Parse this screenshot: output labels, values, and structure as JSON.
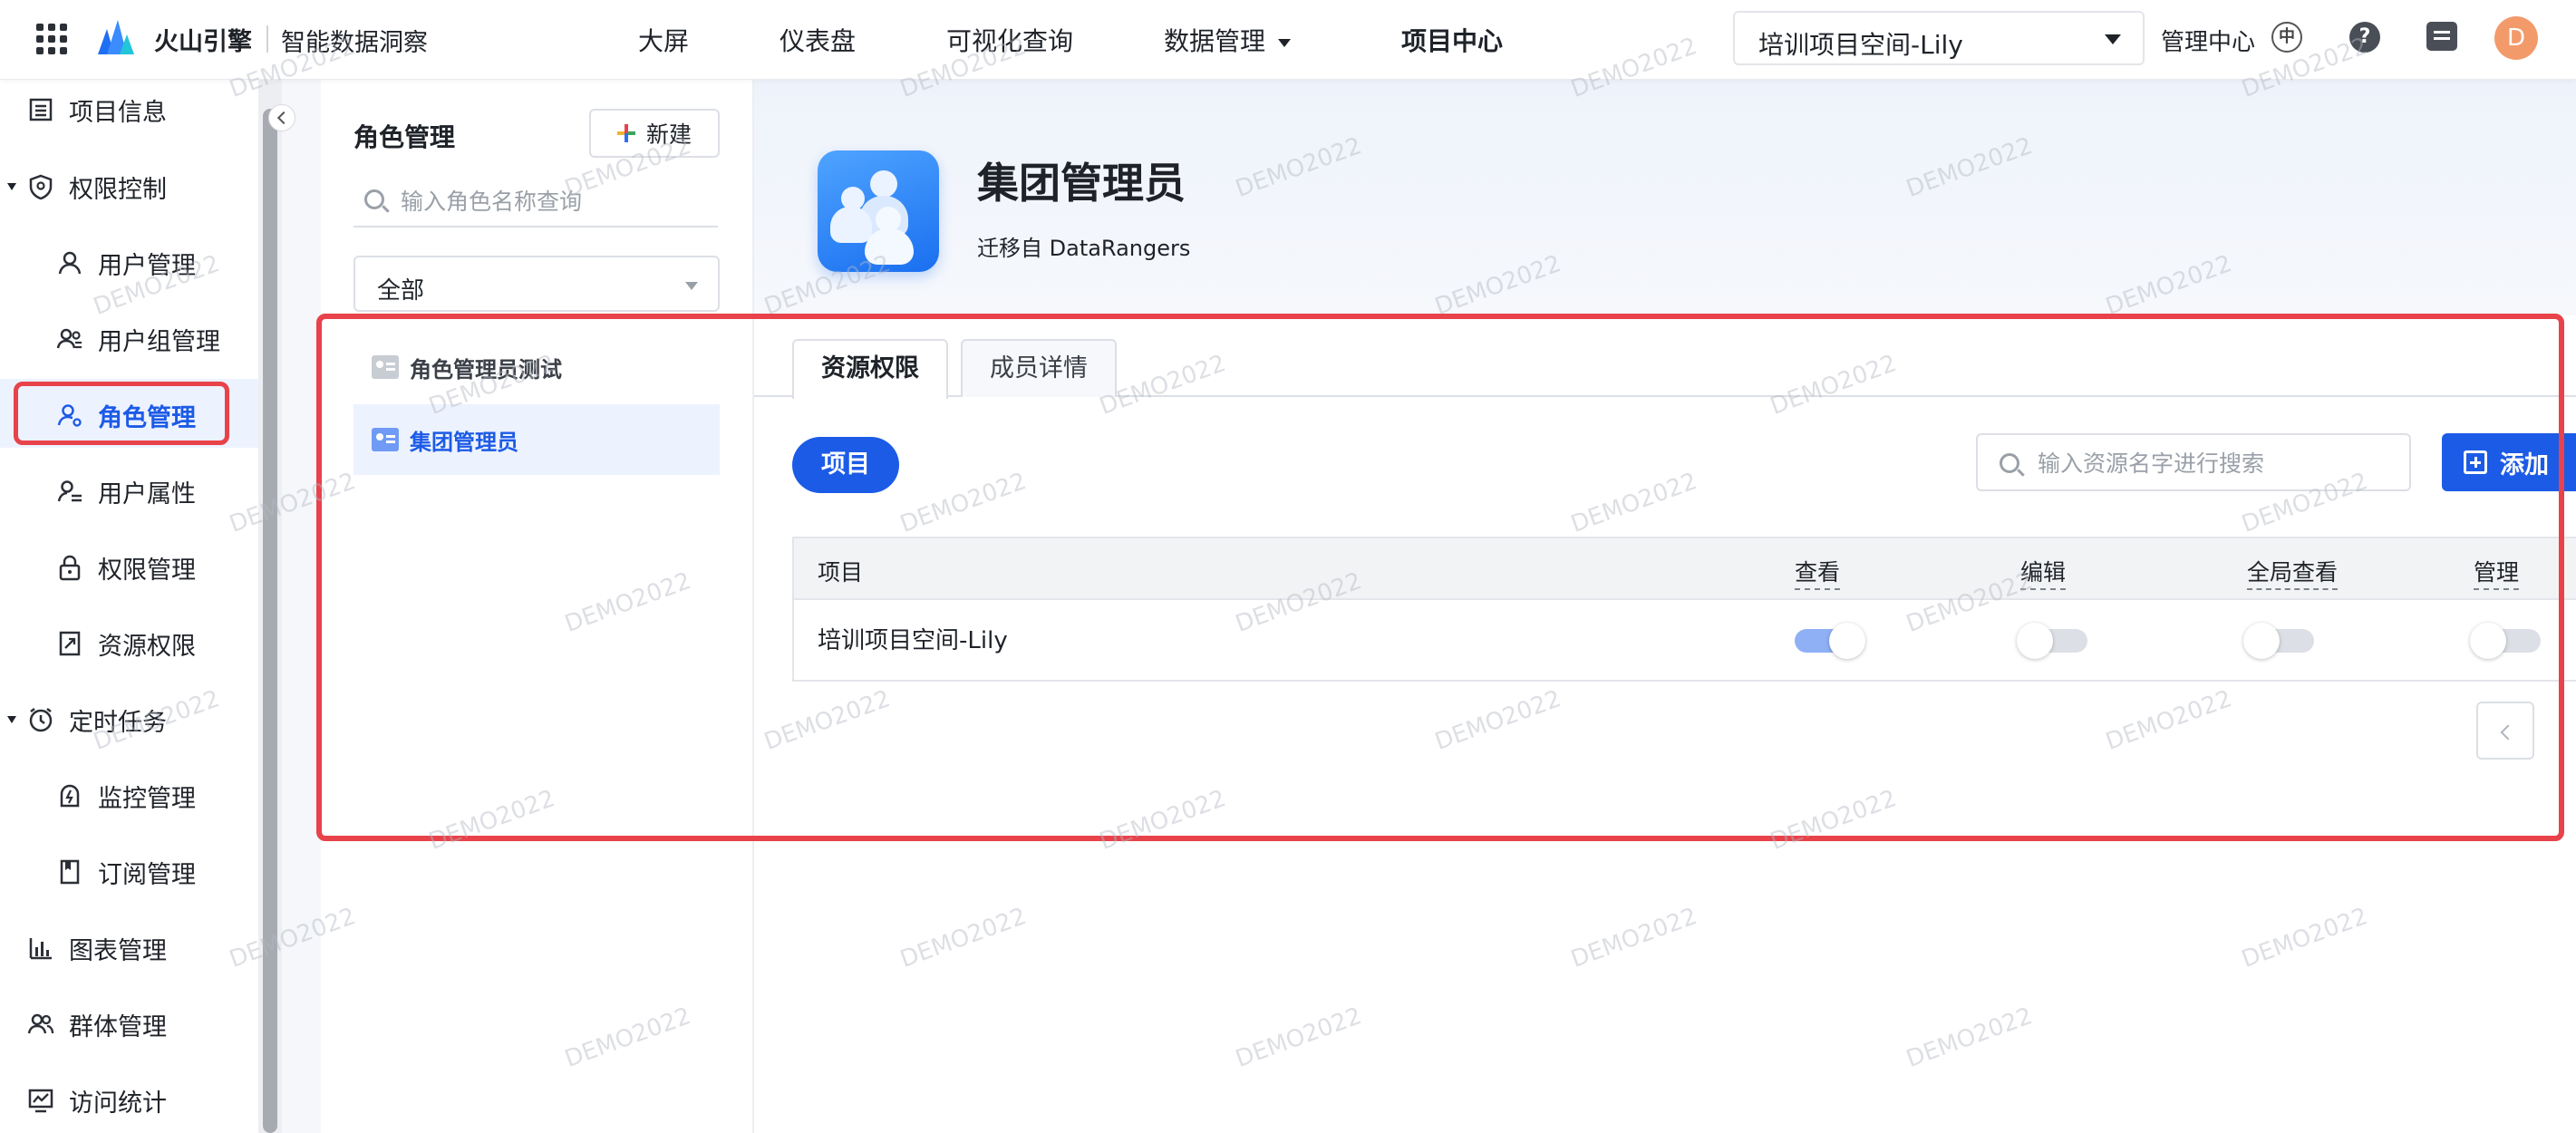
{
  "topbar": {
    "brand": "火山引擎",
    "product": "智能数据洞察",
    "nav": [
      {
        "label": "大屏"
      },
      {
        "label": "仪表盘"
      },
      {
        "label": "可视化查询"
      },
      {
        "label": "数据管理"
      },
      {
        "label": "项目中心"
      }
    ],
    "project_select": "培训项目空间-Lily",
    "admin_center": "管理中心",
    "zh_icon_text": "中",
    "help_icon_text": "?",
    "avatar_letter": "D"
  },
  "sidebar": {
    "items": [
      {
        "label": "项目信息",
        "icon": "list-icon"
      },
      {
        "label": "权限控制",
        "icon": "shield-icon"
      },
      {
        "label": "用户管理",
        "icon": "user-icon"
      },
      {
        "label": "用户组管理",
        "icon": "user-group-icon"
      },
      {
        "label": "角色管理",
        "icon": "role-icon"
      },
      {
        "label": "用户属性",
        "icon": "user-attribute-icon"
      },
      {
        "label": "权限管理",
        "icon": "lock-icon"
      },
      {
        "label": "资源权限",
        "icon": "resource-icon"
      },
      {
        "label": "定时任务",
        "icon": "clock-icon"
      },
      {
        "label": "监控管理",
        "icon": "monitor-icon"
      },
      {
        "label": "订阅管理",
        "icon": "bookmark-icon"
      },
      {
        "label": "图表管理",
        "icon": "bar-chart-icon"
      },
      {
        "label": "群体管理",
        "icon": "group-icon"
      },
      {
        "label": "访问统计",
        "icon": "stats-icon"
      }
    ]
  },
  "role_panel": {
    "title": "角色管理",
    "new_label": "新建",
    "search_placeholder": "输入角色名称查询",
    "filter_value": "全部",
    "roles": [
      {
        "name": "角色管理员测试",
        "selected": false
      },
      {
        "name": "集团管理员",
        "selected": true
      }
    ]
  },
  "detail": {
    "role_name": "集团管理员",
    "source": "迁移自 DataRangers",
    "tabs": [
      {
        "label": "资源权限",
        "active": true
      },
      {
        "label": "成员详情",
        "active": false
      }
    ],
    "resource_type_label": "项目",
    "resource_search_placeholder": "输入资源名字进行搜索",
    "add_label": "添加",
    "table": {
      "columns": [
        "项目",
        "查看",
        "编辑",
        "全局查看",
        "管理"
      ],
      "rows": [
        {
          "name": "培训项目空间-Lily",
          "view": true,
          "edit": false,
          "global_view": false,
          "manage": false
        }
      ]
    }
  },
  "watermark": "DEMO2022",
  "colors": {
    "primary": "#1c5be6",
    "highlight": "#e8424a",
    "active_bg": "#edf2ff"
  }
}
